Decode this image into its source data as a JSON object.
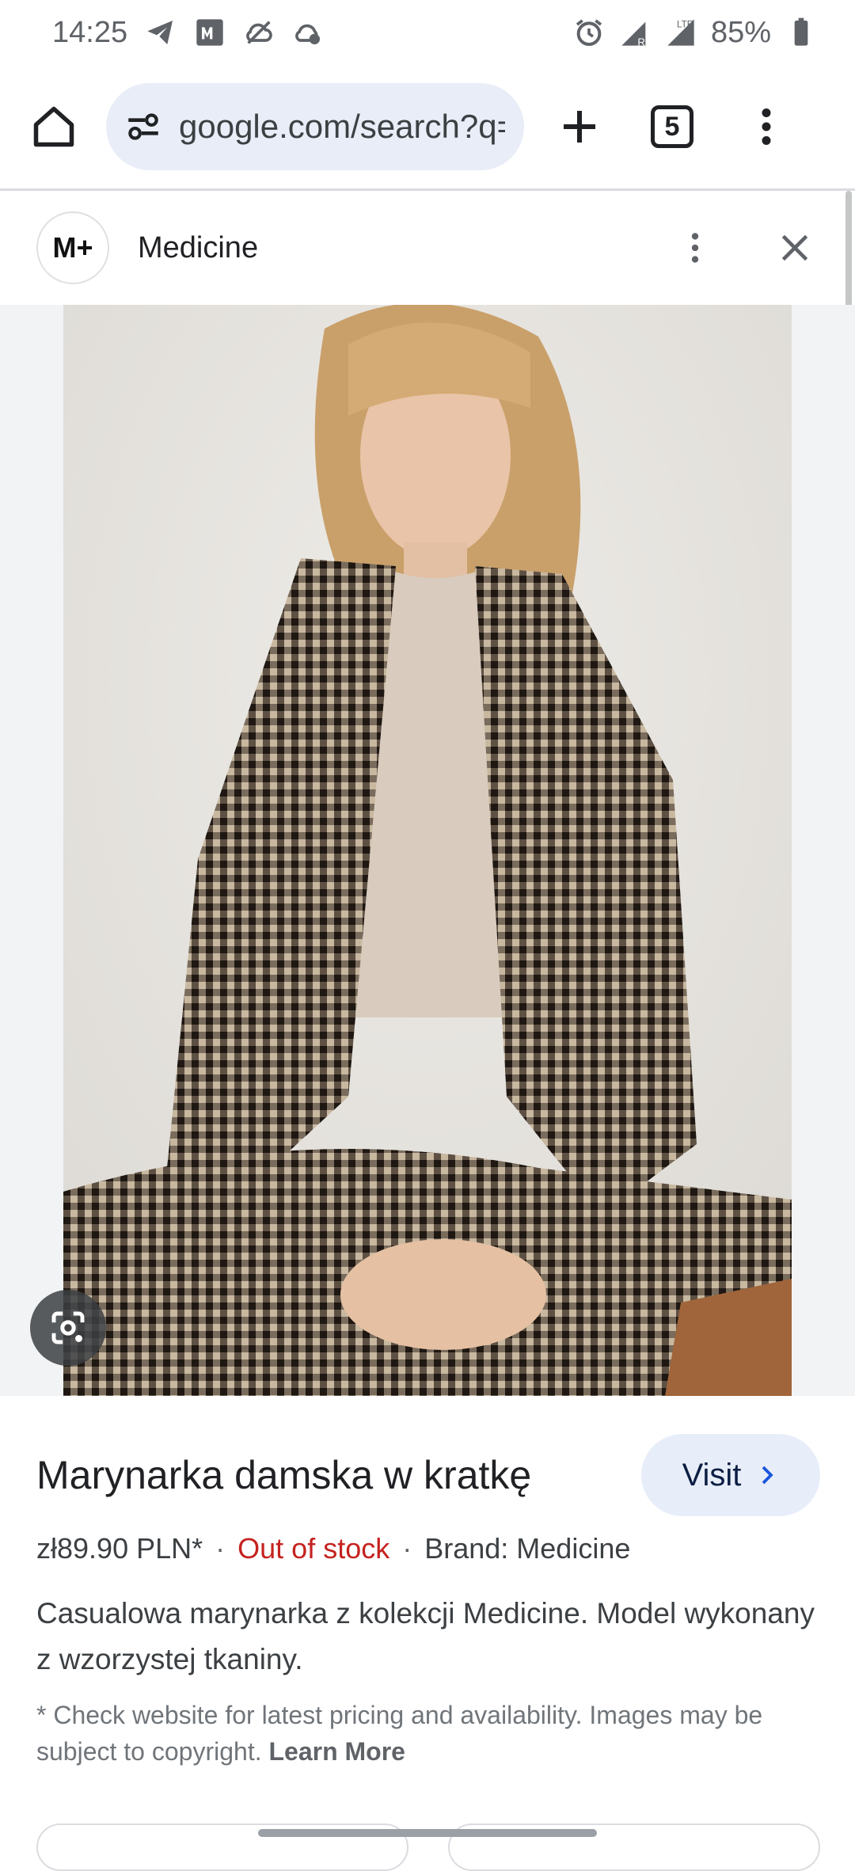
{
  "status_bar": {
    "time": "14:25",
    "icons_left": [
      "telegram-icon",
      "m-app-icon",
      "cloud-off-icon",
      "cloud-sync-icon"
    ],
    "icons_right": [
      "alarm-icon",
      "signal-r-icon",
      "signal-lte-icon",
      "battery-icon"
    ],
    "lte_label": "LTE",
    "battery": "85%"
  },
  "toolbar": {
    "url": "google.com/search?q=",
    "tab_count": "5"
  },
  "source": {
    "logo_text": "M+",
    "name": "Medicine"
  },
  "product": {
    "title": "Marynarka damska w kratkę",
    "visit_label": "Visit",
    "price": "zł89.90 PLN*",
    "separator": "·",
    "stock": "Out of stock",
    "brand": "Brand: Medicine",
    "description": "Casualowa marynarka z kolekcji Medicine. Model wykonany z wzorzystej tkaniny.",
    "disclaimer": "* Check website for latest pricing and availability. Images may be subject to copyright.",
    "learn_more": "Learn More"
  },
  "colors": {
    "accent_pill": "#e8edf7",
    "stock_red": "#c5221f",
    "visit_bg": "#e8eef9"
  }
}
